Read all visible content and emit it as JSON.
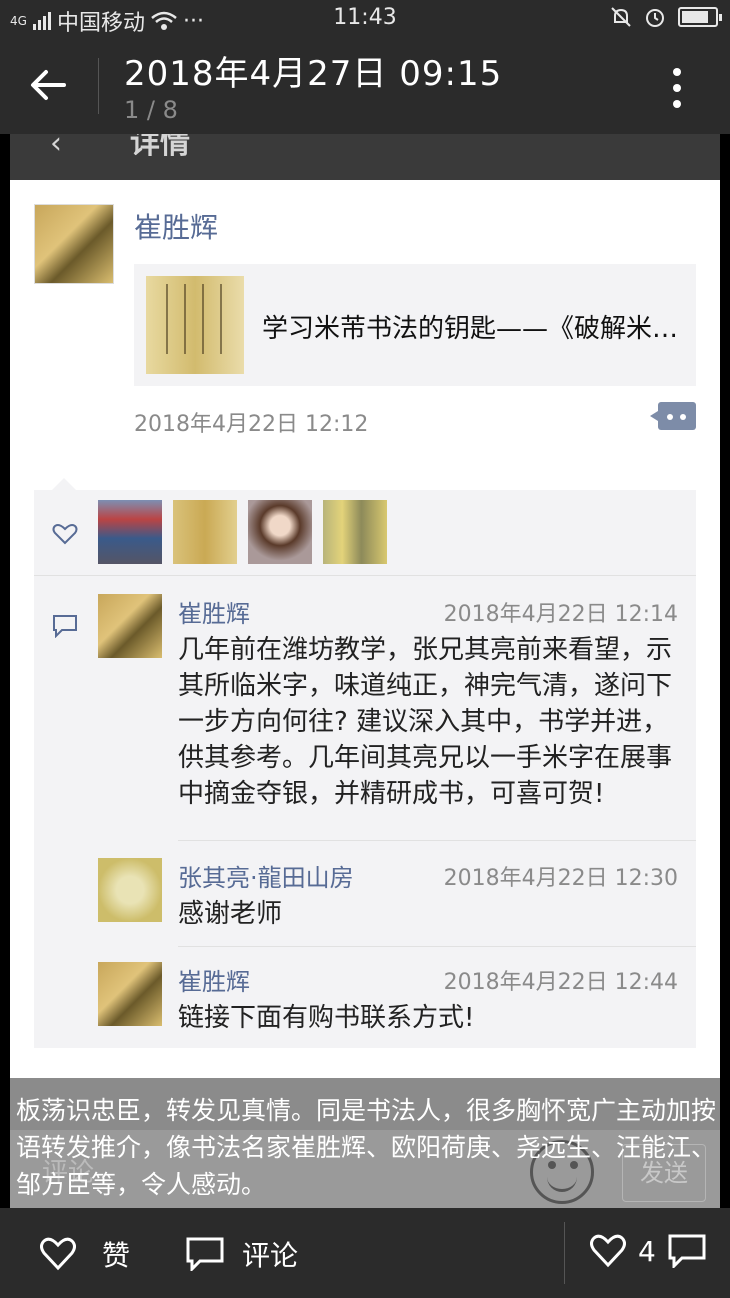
{
  "status_bar": {
    "signal_text": "4G",
    "carrier": "中国移动",
    "dots": "···",
    "time": "11:43"
  },
  "header": {
    "title": "2018年4月27日 09:15",
    "page_indicator": "1 / 8",
    "ghost_title": "详情"
  },
  "post": {
    "author": "崔胜辉",
    "link_title": "学习米芾书法的钥匙——《破解米…",
    "time": "2018年4月22日 12:12",
    "likes": [
      "avatar-man",
      "avatar-calligraphy",
      "avatar-woman",
      "avatar-calligraphy-2"
    ],
    "comments": [
      {
        "name": "崔胜辉",
        "time": "2018年4月22日 12:14",
        "text": "几年前在潍坊教学，张兄其亮前来看望，示其所临米字，味道纯正，神完气清，遂问下一步方向何往? 建议深入其中，书学并进，供其参考。几年间其亮兄以一手米字在展事中摘金夺银，并精研成书，可喜可贺!"
      },
      {
        "name": "张其亮·龍田山房",
        "time": "2018年4月22日 12:30",
        "text": "感谢老师"
      },
      {
        "name": "崔胜辉",
        "time": "2018年4月22日 12:44",
        "text": "链接下面有购书联系方式!"
      }
    ]
  },
  "comment_input": {
    "placeholder": "评论",
    "send_label": "发送"
  },
  "caption": "板荡识忠臣，转发见真情。同是书法人，很多胸怀宽广主动加按语转发推介，像书法名家崔胜辉、欧阳荷庚、尧远生、汪能江、邹方臣等，令人感动。",
  "bottom_bar": {
    "like_label": "赞",
    "comment_label": "评论",
    "like_count": "4"
  }
}
